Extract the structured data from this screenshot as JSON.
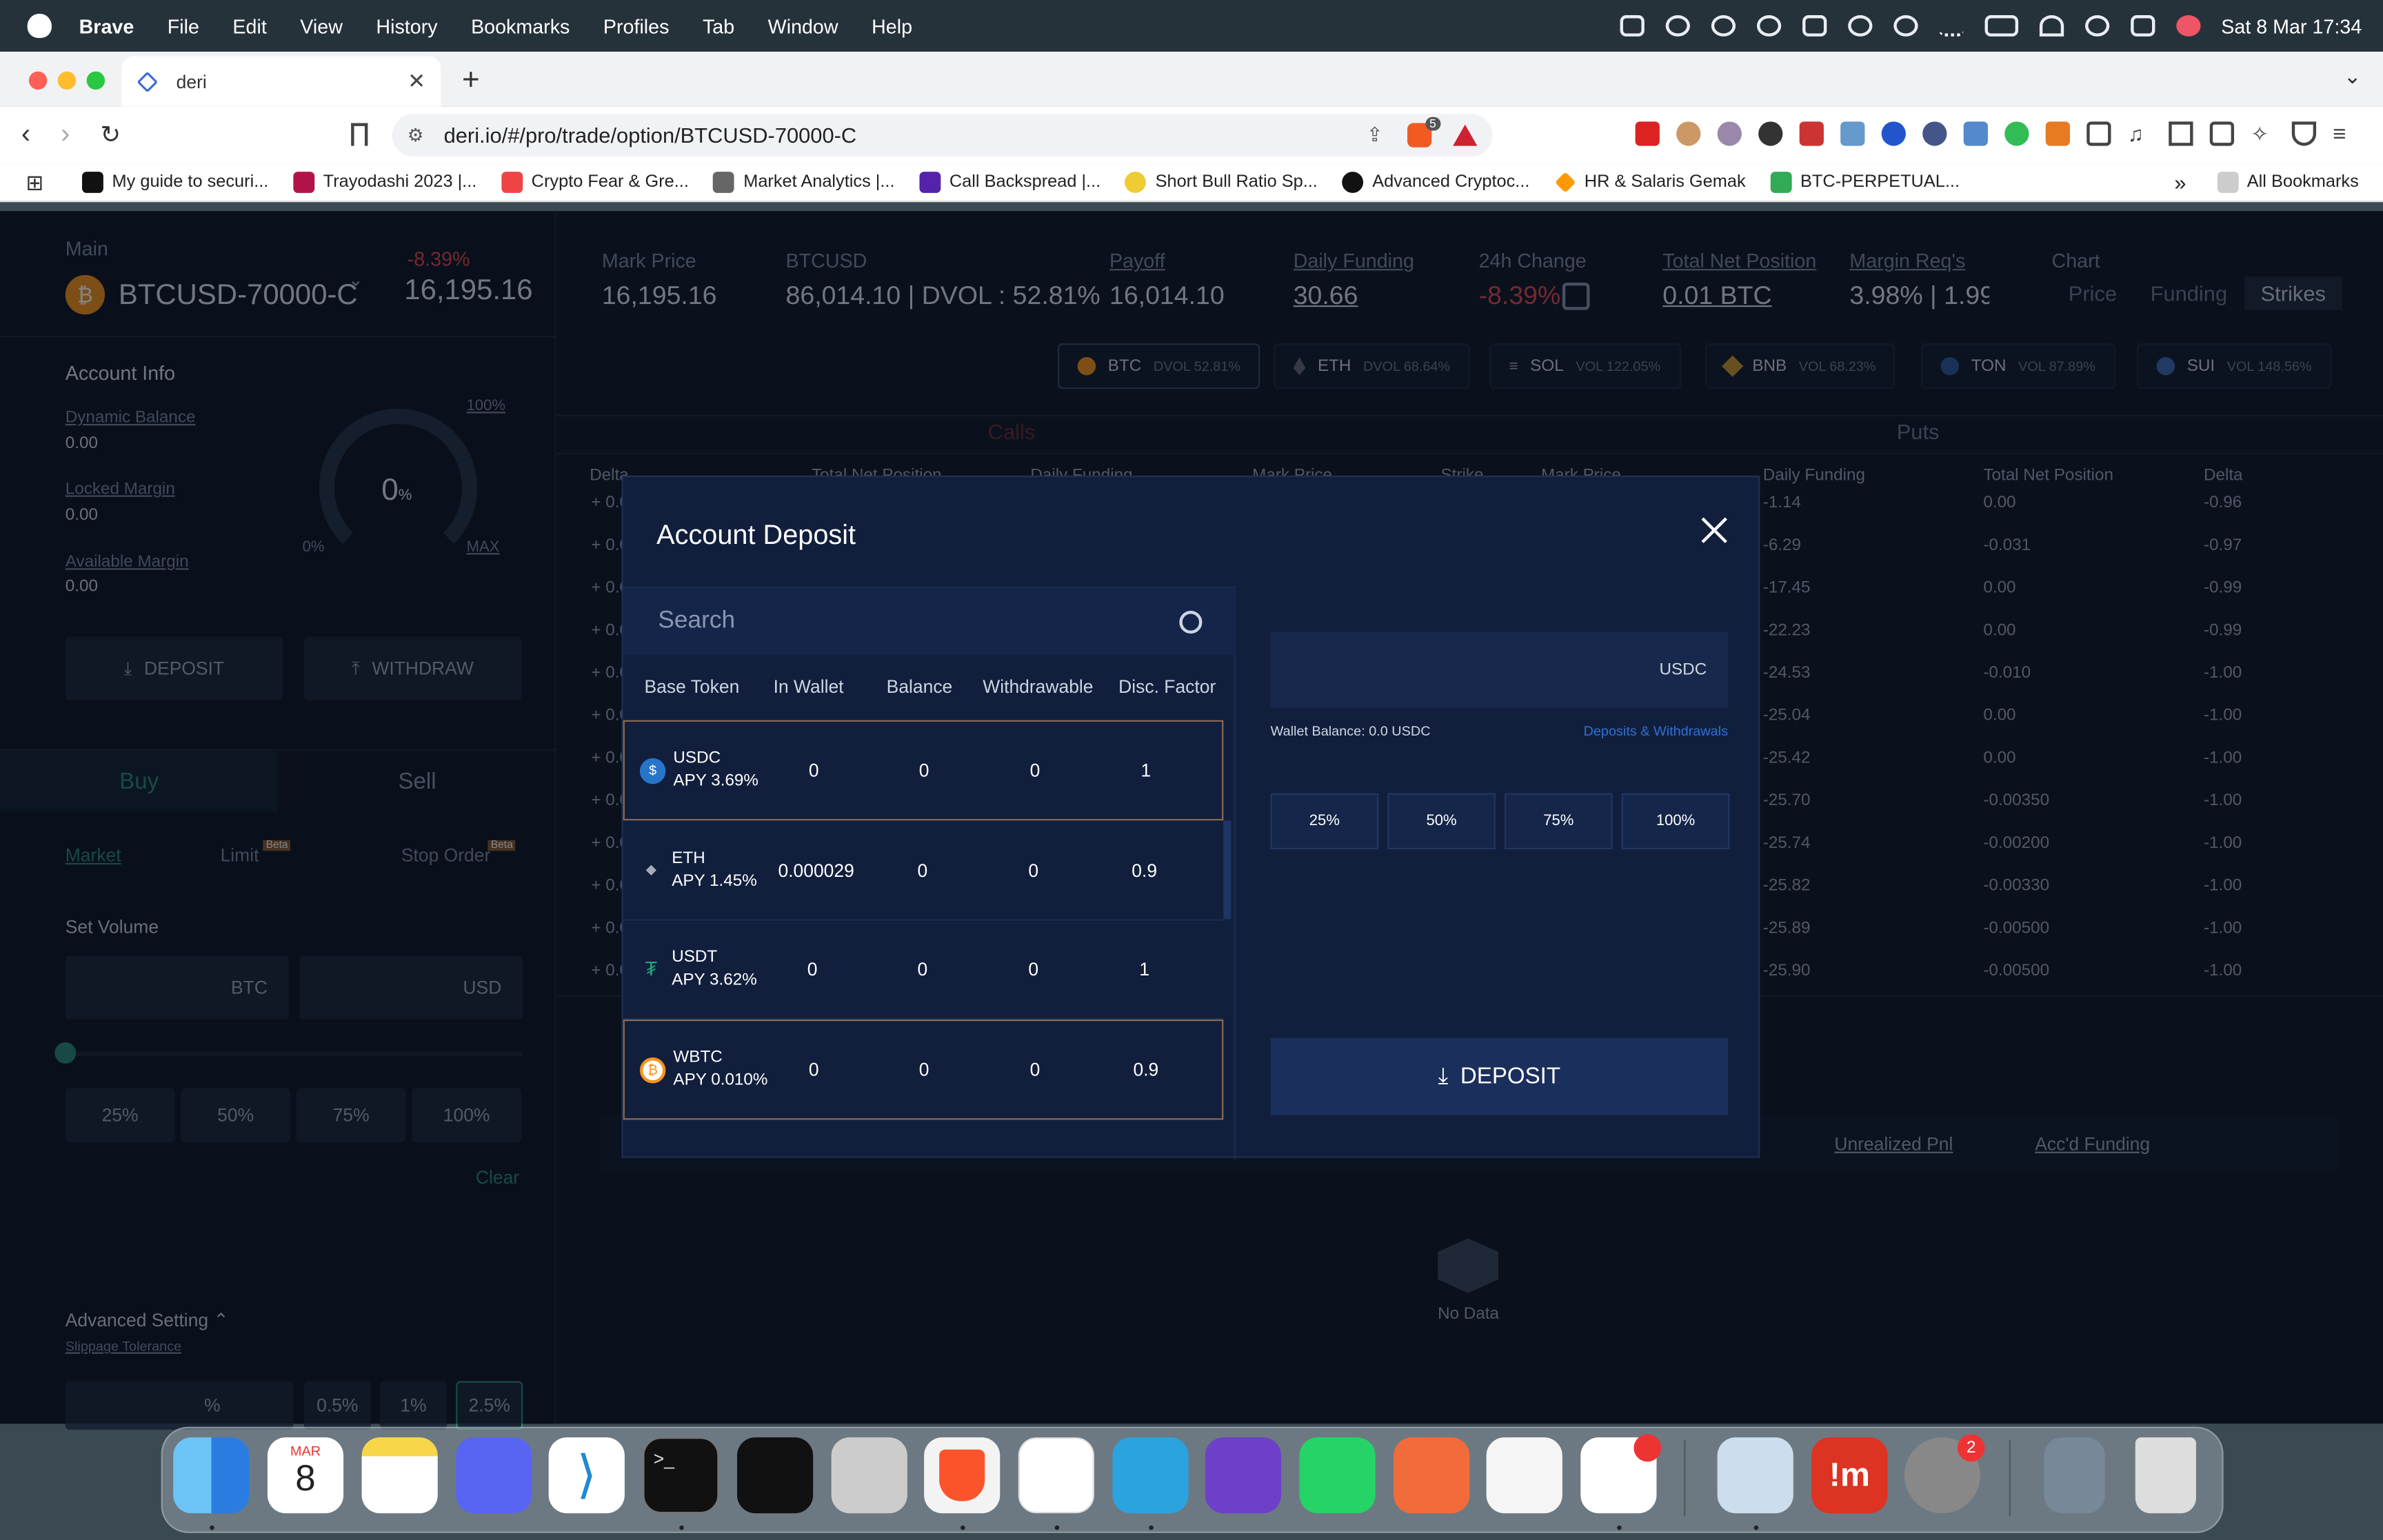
{
  "menubar": {
    "app": "Brave",
    "items": [
      "File",
      "Edit",
      "View",
      "History",
      "Bookmarks",
      "Profiles",
      "Tab",
      "Window",
      "Help"
    ],
    "datetime": "Sat 8 Mar  17:34"
  },
  "browser": {
    "tab_title": "deri",
    "url": "deri.io/#/pro/trade/option/BTCUSD-70000-C",
    "shield_badge": "5",
    "bookmarks": [
      "My guide to securi...",
      "Trayodashi 2023 |...",
      "Crypto Fear & Gre...",
      "Market Analytics |...",
      "Call Backspread |...",
      "Short Bull Ratio Sp...",
      "Advanced Cryptoc...",
      "HR & Salaris Gemak",
      "BTC-PERPETUAL..."
    ],
    "all_bookmarks": "All Bookmarks"
  },
  "header": {
    "main_label": "Main",
    "symbol": "BTCUSD-70000-C",
    "change": "-8.39%",
    "price": "16,195.16",
    "stats": [
      {
        "label": "Mark Price",
        "value": "16,195.16"
      },
      {
        "label": "BTCUSD",
        "value": "86,014.10 | DVOL : 52.81%"
      },
      {
        "label": "Payoff",
        "value": "16,014.10"
      },
      {
        "label": "Daily Funding",
        "value": "30.66"
      },
      {
        "label": "24h Change",
        "value": "-8.39%"
      },
      {
        "label": "Total Net Position",
        "value": "0.01 BTC"
      },
      {
        "label": "Margin Req's",
        "value": "3.98% | 1.99%"
      }
    ],
    "chart_label": "Chart",
    "chart_tabs": [
      "Price",
      "Funding",
      "Strikes"
    ]
  },
  "account": {
    "title": "Account Info",
    "dynamic_balance_label": "Dynamic Balance",
    "dynamic_balance": "0.00",
    "locked_margin_label": "Locked Margin",
    "locked_margin": "0.00",
    "available_margin_label": "Available Margin",
    "available_margin": "0.00",
    "gauge_value": "0",
    "gauge_unit": "%",
    "gauge_min": "0%",
    "gauge_max": "100%",
    "gauge_max_label": "MAX",
    "deposit": "DEPOSIT",
    "withdraw": "WITHDRAW"
  },
  "order": {
    "buy": "Buy",
    "sell": "Sell",
    "market": "Market",
    "limit": "Limit",
    "stop": "Stop Order",
    "beta": "Beta",
    "set_volume": "Set Volume",
    "btc": "BTC",
    "usd": "USD",
    "pcts": [
      "25%",
      "50%",
      "75%",
      "100%"
    ],
    "clear": "Clear",
    "advanced": "Advanced Setting",
    "slippage": "Slippage Tolerance",
    "slip_unit": "%",
    "slip_opts": [
      "0.5%",
      "1%",
      "2.5%"
    ]
  },
  "assets": [
    {
      "name": "BTC",
      "vol": "DVOL 52.81%"
    },
    {
      "name": "ETH",
      "vol": "DVOL 68.64%"
    },
    {
      "name": "SOL",
      "vol": "VOL 122.05%"
    },
    {
      "name": "BNB",
      "vol": "VOL 68.23%"
    },
    {
      "name": "TON",
      "vol": "VOL 87.89%"
    },
    {
      "name": "SUI",
      "vol": "VOL 148.56%"
    }
  ],
  "chain": {
    "calls": "Calls",
    "puts": "Puts",
    "left_headers": [
      "Delta",
      "Total Net Position",
      "Daily Funding",
      "Mark Price",
      "Strike",
      "Mark Price"
    ],
    "right_headers": [
      "Daily Funding",
      "Total Net Position",
      "Delta"
    ],
    "rows": [
      [
        "-1.14",
        "0.00",
        "-0.96"
      ],
      [
        "-6.29",
        "-0.031",
        "-0.97"
      ],
      [
        "-17.45",
        "0.00",
        "-0.99"
      ],
      [
        "-22.23",
        "0.00",
        "-0.99"
      ],
      [
        "-24.53",
        "-0.010",
        "-1.00"
      ],
      [
        "-25.04",
        "0.00",
        "-1.00"
      ],
      [
        "-25.42",
        "0.00",
        "-1.00"
      ],
      [
        "-25.70",
        "-0.00350",
        "-1.00"
      ],
      [
        "-25.74",
        "-0.00200",
        "-1.00"
      ],
      [
        "-25.82",
        "-0.00330",
        "-1.00"
      ],
      [
        "-25.89",
        "-0.00500",
        "-1.00"
      ],
      [
        "-25.90",
        "-0.00500",
        "-1.00"
      ]
    ],
    "left_delta": "+ 0.0"
  },
  "positions": {
    "unrealized": "Unrealized Pnl",
    "funding": "Acc'd Funding",
    "empty": "No Data"
  },
  "modal": {
    "title": "Account Deposit",
    "search_placeholder": "Search",
    "columns": [
      "Base Token",
      "In Wallet",
      "Balance",
      "Withdrawable",
      "Disc. Factor"
    ],
    "tokens": [
      {
        "name": "USDC",
        "apy": "APY  3.69%",
        "wallet": "0",
        "balance": "0",
        "withdrawable": "0",
        "disc": "1",
        "color": "#2775ca"
      },
      {
        "name": "ETH",
        "apy": "APY  1.45%",
        "wallet": "0.000029",
        "balance": "0",
        "withdrawable": "0",
        "disc": "0.9",
        "color": "#3b3f55"
      },
      {
        "name": "USDT",
        "apy": "APY  3.62%",
        "wallet": "0",
        "balance": "0",
        "withdrawable": "0",
        "disc": "1",
        "color": "#26a17b"
      },
      {
        "name": "WBTC",
        "apy": "APY  0.010%",
        "wallet": "0",
        "balance": "0",
        "withdrawable": "0",
        "disc": "0.9",
        "color": "#f7931a"
      }
    ],
    "unit": "USDC",
    "wallet_balance": "Wallet Balance: 0.0 USDC",
    "deposits_link": "Deposits & Withdrawals",
    "pcts": [
      "25%",
      "50%",
      "75%",
      "100%"
    ],
    "deposit": "DEPOSIT"
  },
  "dock": {
    "calendar_month": "MAR",
    "calendar_day": "8",
    "slack_badge": "",
    "settings_badge": "2"
  }
}
